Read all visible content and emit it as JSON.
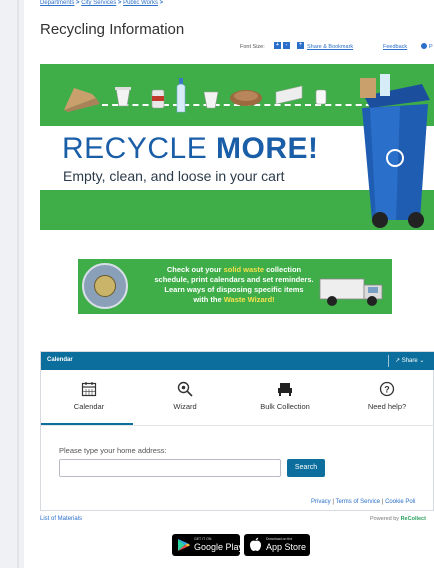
{
  "breadcrumb": [
    "Departments",
    "City Services",
    "Public Works"
  ],
  "page_title": "Recycling Information",
  "toolbar": {
    "font_size_label": "Font Size:",
    "font_increase": "+",
    "font_decrease": "-",
    "share_label": "Share & Bookmark",
    "feedback_label": "Feedback",
    "print_label": "P"
  },
  "hero": {
    "heading_plain": "RECYCLE ",
    "heading_bold": "MORE!",
    "subheading": "Empty, clean, and loose in your cart",
    "accent_color": "#3fae49",
    "heading_color": "#1a5ea8"
  },
  "waste_banner": {
    "line1_pre": "Check out your ",
    "line1_highlight": "solid waste",
    "line1_post": " collection",
    "line2": "schedule, print calendars and set reminders.",
    "line3": "Learn ways of disposing specific items",
    "line4_pre": "with the ",
    "line4_highlight": "Waste Wizard!"
  },
  "widget": {
    "title": "Calendar",
    "share_label": "Share",
    "tabs": [
      {
        "label": "Calendar",
        "icon": "calendar-icon"
      },
      {
        "label": "Wizard",
        "icon": "wizard-search-icon"
      },
      {
        "label": "Bulk Collection",
        "icon": "couch-icon"
      },
      {
        "label": "Need help?",
        "icon": "help-icon"
      }
    ],
    "address_label": "Please type your home address:",
    "address_value": "",
    "search_button": "Search",
    "footer_privacy": "Privacy",
    "footer_separator": "|",
    "footer_terms": "Terms of Service",
    "footer_cookie": "Cookie Poli",
    "accent_color": "#0c6e9c"
  },
  "list_of_materials": "List of Materials",
  "powered_by": {
    "prefix": "Powered by ",
    "brand": "ReCollect"
  },
  "store_badges": {
    "google": {
      "small": "GET IT ON",
      "big": "Google Play"
    },
    "apple": {
      "small": "Download on the",
      "big": "App Store"
    }
  }
}
